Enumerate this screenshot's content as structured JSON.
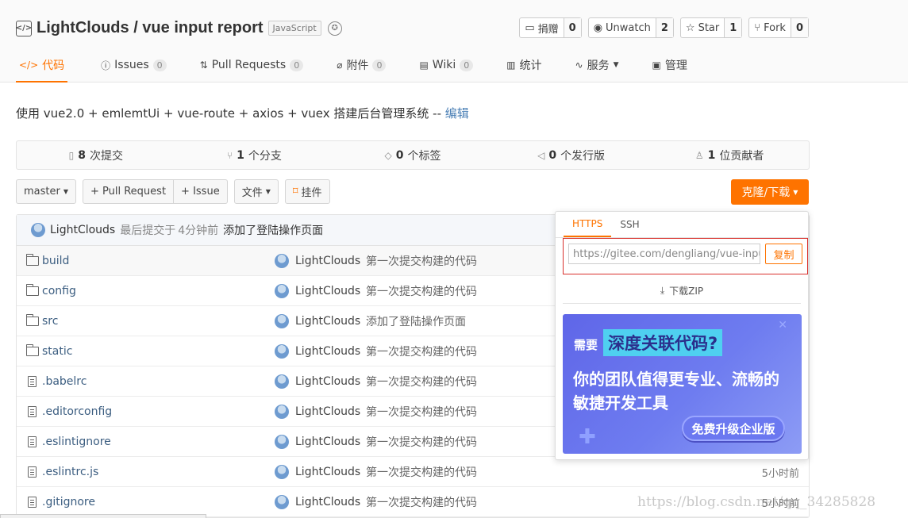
{
  "repo": {
    "title": "LightClouds / vue input report",
    "language": "JavaScript",
    "icon_text": "</>"
  },
  "actions": [
    {
      "label": "捐赠",
      "count": "0",
      "icon": "donate-icon"
    },
    {
      "label": "Unwatch",
      "count": "2",
      "icon": "eye-icon"
    },
    {
      "label": "Star",
      "count": "1",
      "icon": "star-icon"
    },
    {
      "label": "Fork",
      "count": "0",
      "icon": "fork-icon"
    }
  ],
  "tabs": [
    {
      "label": "代码",
      "count": null,
      "icon": "code-icon"
    },
    {
      "label": "Issues",
      "count": "0",
      "icon": "issues-icon"
    },
    {
      "label": "Pull Requests",
      "count": "0",
      "icon": "pull-request-icon"
    },
    {
      "label": "附件",
      "count": "0",
      "icon": "attachment-icon"
    },
    {
      "label": "Wiki",
      "count": "0",
      "icon": "wiki-icon"
    },
    {
      "label": "统计",
      "count": null,
      "icon": "stats-icon"
    },
    {
      "label": "服务",
      "count": null,
      "icon": "service-icon"
    },
    {
      "label": "管理",
      "count": null,
      "icon": "manage-icon"
    }
  ],
  "description": {
    "text": "使用 vue2.0 + emlemtUi + vue-route + axios + vuex 搭建后台管理系统 -- ",
    "edit": "编辑"
  },
  "stats": [
    {
      "num": "8",
      "label": "次提交",
      "icon": "commits-icon"
    },
    {
      "num": "1",
      "label": "个分支",
      "icon": "branch-icon"
    },
    {
      "num": "0",
      "label": "个标签",
      "icon": "tag-icon"
    },
    {
      "num": "0",
      "label": "个发行版",
      "icon": "release-icon"
    },
    {
      "num": "1",
      "label": "位贡献者",
      "icon": "contributors-icon"
    }
  ],
  "toolbar": {
    "branch": "master",
    "pull_request": "+ Pull Request",
    "issue": "+ Issue",
    "file": "文件",
    "widget": "挂件",
    "clone": "克隆/下载"
  },
  "last_commit": {
    "author": "LightClouds",
    "prefix": "最后提交于",
    "time": "4分钟前",
    "message": "添加了登陆操作页面"
  },
  "files": [
    {
      "name": "build",
      "type": "folder",
      "author": "LightClouds",
      "message": "第一次提交构建的代码",
      "time": ""
    },
    {
      "name": "config",
      "type": "folder",
      "author": "LightClouds",
      "message": "第一次提交构建的代码",
      "time": ""
    },
    {
      "name": "src",
      "type": "folder",
      "author": "LightClouds",
      "message": "添加了登陆操作页面",
      "time": ""
    },
    {
      "name": "static",
      "type": "folder",
      "author": "LightClouds",
      "message": "第一次提交构建的代码",
      "time": ""
    },
    {
      "name": ".babelrc",
      "type": "file",
      "author": "LightClouds",
      "message": "第一次提交构建的代码",
      "time": ""
    },
    {
      "name": ".editorconfig",
      "type": "file",
      "author": "LightClouds",
      "message": "第一次提交构建的代码",
      "time": ""
    },
    {
      "name": ".eslintignore",
      "type": "file",
      "author": "LightClouds",
      "message": "第一次提交构建的代码",
      "time": ""
    },
    {
      "name": ".eslintrc.js",
      "type": "file",
      "author": "LightClouds",
      "message": "第一次提交构建的代码",
      "time": "5小时前"
    },
    {
      "name": ".gitignore",
      "type": "file",
      "author": "LightClouds",
      "message": "第一次提交构建的代码",
      "time": "5小时前"
    }
  ],
  "clone_panel": {
    "tabs": [
      "HTTPS",
      "SSH"
    ],
    "url": "https://gitee.com/dengliang/vue-input",
    "copy": "复制",
    "zip": "下载ZIP",
    "promo": {
      "need": "需要",
      "highlight": "深度关联代码?",
      "line1": "你的团队值得更专业、流畅的",
      "line2": "敏捷开发工具",
      "cta": "免费升级企业版"
    }
  },
  "watermark": "https://blog.csdn.net/qq_34285828",
  "colors": {
    "accent": "#fe7300",
    "link": "#4a7fb5",
    "promo": "#6e7cf0"
  }
}
